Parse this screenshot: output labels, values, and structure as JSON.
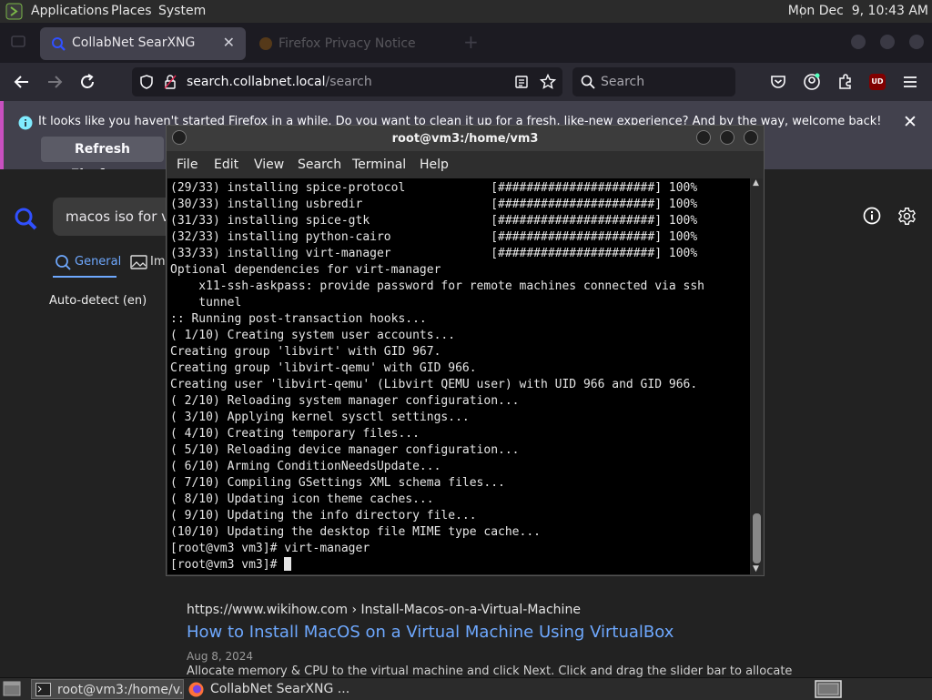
{
  "top_panel": {
    "menus": [
      "Applications",
      "Places",
      "System"
    ],
    "clock": "Mon Dec  9, 10:43 AM"
  },
  "firefox": {
    "tabs": [
      {
        "label": "CollabNet SearXNG",
        "active": true
      },
      {
        "label": "Firefox Privacy Notice",
        "active": false
      }
    ],
    "url": "search.collabnet.local/search",
    "url_host": "search.collabnet.local",
    "url_path": "/search",
    "search_placeholder": "Search",
    "notice_text": "It looks like you haven't started Firefox in a while. Do you want to clean it up for a fresh, like-new experience? And by the way, welcome back!",
    "refresh_label": "Refresh Firefox…",
    "addon_badge": "UD"
  },
  "searxng": {
    "query": "macos iso for vi",
    "categories": [
      "General",
      "Ima"
    ],
    "language": "Auto-detect (en)",
    "result": {
      "site": "https://www.wikihow.com",
      "crumb": "› Install-Macos-on-a-Virtual-Machine",
      "title": "How to Install MacOS on a Virtual Machine Using VirtualBox",
      "date": "Aug 8, 2024",
      "snippet": "Allocate memory & CPU to the virtual machine and click Next. Click and drag the slider bar to allocate"
    }
  },
  "terminal": {
    "title": "root@vm3:/home/vm3",
    "menu": [
      "File",
      "Edit",
      "View",
      "Search",
      "Terminal",
      "Help"
    ],
    "lines": [
      "(29/33) installing spice-protocol            [######################] 100%",
      "(30/33) installing usbredir                  [######################] 100%",
      "(31/33) installing spice-gtk                 [######################] 100%",
      "(32/33) installing python-cairo              [######################] 100%",
      "(33/33) installing virt-manager              [######################] 100%",
      "Optional dependencies for virt-manager",
      "    x11-ssh-askpass: provide password for remote machines connected via ssh",
      "    tunnel",
      ":: Running post-transaction hooks...",
      "( 1/10) Creating system user accounts...",
      "Creating group 'libvirt' with GID 967.",
      "Creating group 'libvirt-qemu' with GID 966.",
      "Creating user 'libvirt-qemu' (Libvirt QEMU user) with UID 966 and GID 966.",
      "( 2/10) Reloading system manager configuration...",
      "( 3/10) Applying kernel sysctl settings...",
      "( 4/10) Creating temporary files...",
      "( 5/10) Reloading device manager configuration...",
      "( 6/10) Arming ConditionNeedsUpdate...",
      "( 7/10) Compiling GSettings XML schema files...",
      "( 8/10) Updating icon theme caches...",
      "( 9/10) Updating the info directory file...",
      "(10/10) Updating the desktop file MIME type cache...",
      "[root@vm3 vm3]# virt-manager",
      "[root@vm3 vm3]# "
    ]
  },
  "taskbar": {
    "items": [
      {
        "label": "root@vm3:/home/v..."
      },
      {
        "label": "CollabNet SearXNG ..."
      }
    ]
  }
}
